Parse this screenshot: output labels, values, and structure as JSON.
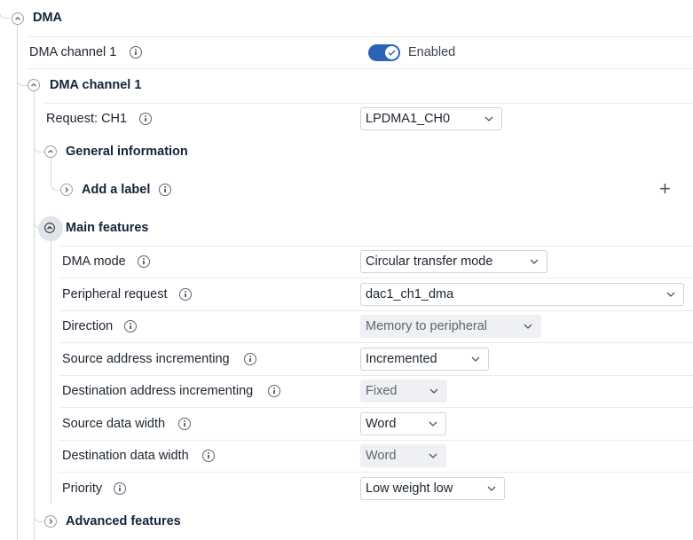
{
  "dma": {
    "section_title": "DMA",
    "channel_toggle_label": "DMA channel 1",
    "channel_toggle_state": "Enabled"
  },
  "channel": {
    "section_title": "DMA channel 1",
    "request_label": "Request: CH1",
    "request_value": "LPDMA1_CH0"
  },
  "general": {
    "section_title": "General information",
    "add_label": "Add a label"
  },
  "main": {
    "section_title": "Main features",
    "rows": [
      {
        "label": "DMA mode",
        "value": "Circular transfer mode",
        "disabled": false
      },
      {
        "label": "Peripheral request",
        "value": "dac1_ch1_dma",
        "disabled": false
      },
      {
        "label": "Direction",
        "value": "Memory to peripheral",
        "disabled": true
      },
      {
        "label": "Source address incrementing",
        "value": "Incremented",
        "disabled": false
      },
      {
        "label": "Destination address incrementing",
        "value": "Fixed",
        "disabled": true
      },
      {
        "label": "Source data width",
        "value": "Word",
        "disabled": false
      },
      {
        "label": "Destination data width",
        "value": "Word",
        "disabled": true
      },
      {
        "label": "Priority",
        "value": "Low weight low",
        "disabled": false
      }
    ]
  },
  "advanced": {
    "section_title": "Advanced features"
  },
  "colors": {
    "accent": "#2a63b8",
    "title": "#13233a",
    "line": "#d4d8dd"
  }
}
